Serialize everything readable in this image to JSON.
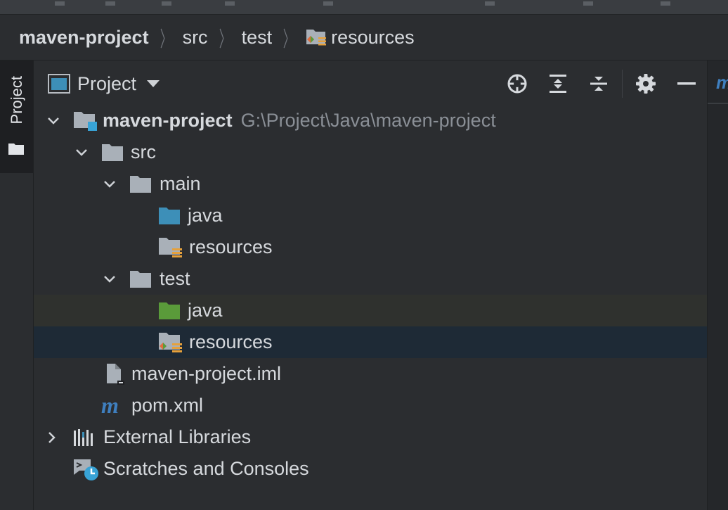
{
  "breadcrumb": {
    "items": [
      "maven-project",
      "src",
      "test",
      "resources"
    ]
  },
  "sidebar": {
    "tab_label": "Project"
  },
  "panel": {
    "title": "Project",
    "tools": [
      "locate-icon",
      "expand-all-icon",
      "collapse-all-icon",
      "gear-icon",
      "minimize-icon"
    ]
  },
  "tree": {
    "root_label": "maven-project",
    "root_path": "G:\\Project\\Java\\maven-project",
    "src": "src",
    "main": "main",
    "main_java": "java",
    "main_resources": "resources",
    "test": "test",
    "test_java": "java",
    "test_resources": "resources",
    "iml": "maven-project.iml",
    "pom": "pom.xml",
    "external_libraries": "External Libraries",
    "scratches": "Scratches and Consoles"
  },
  "colors": {
    "folder_gray": "#a9b0b8",
    "source_blue": "#3d8fb8",
    "test_green": "#5a9b3a",
    "resources_orange": "#e6a13c",
    "selection": "#1e2a36",
    "maven_blue": "#3f7fbf"
  }
}
